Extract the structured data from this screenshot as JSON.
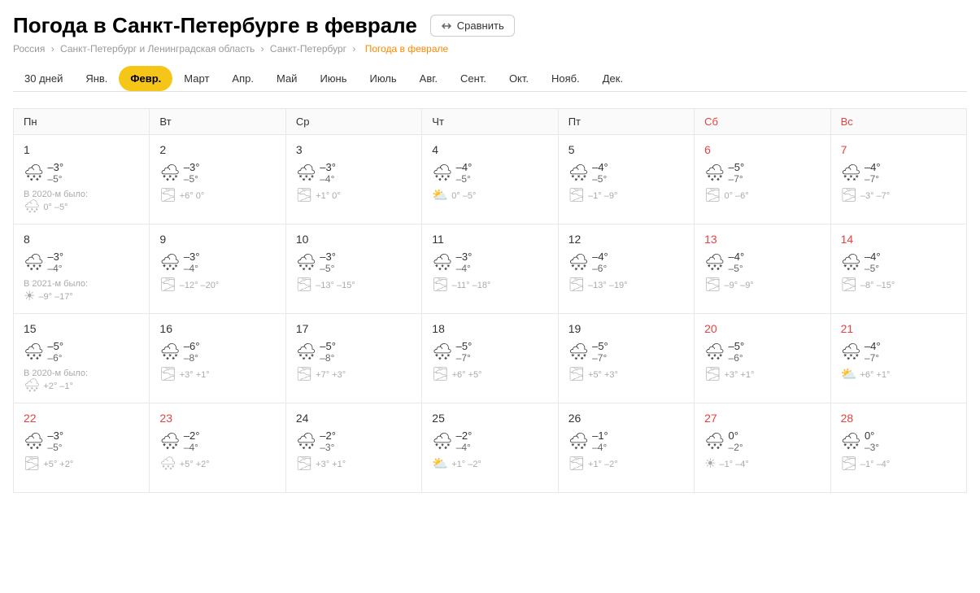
{
  "page": {
    "title": "Погода в Санкт-Петербурге в феврале",
    "compare_btn": "Сравнить",
    "breadcrumb": {
      "items": [
        "Россия",
        "Санкт-Петербург и Ленинградская область",
        "Санкт-Петербург"
      ],
      "current": "Погода в феврале"
    }
  },
  "tabs": [
    {
      "label": "30 дней",
      "active": false
    },
    {
      "label": "Янв.",
      "active": false
    },
    {
      "label": "Февр.",
      "active": true
    },
    {
      "label": "Март",
      "active": false
    },
    {
      "label": "Апр.",
      "active": false
    },
    {
      "label": "Май",
      "active": false
    },
    {
      "label": "Июнь",
      "active": false
    },
    {
      "label": "Июль",
      "active": false
    },
    {
      "label": "Авг.",
      "active": false
    },
    {
      "label": "Сент.",
      "active": false
    },
    {
      "label": "Окт.",
      "active": false
    },
    {
      "label": "Нояб.",
      "active": false
    },
    {
      "label": "Дек.",
      "active": false
    }
  ],
  "headers": [
    {
      "label": "Пн",
      "weekend": false
    },
    {
      "label": "Вт",
      "weekend": false
    },
    {
      "label": "Ср",
      "weekend": false
    },
    {
      "label": "Чт",
      "weekend": false
    },
    {
      "label": "Пт",
      "weekend": false
    },
    {
      "label": "Сб",
      "weekend": true
    },
    {
      "label": "Вс",
      "weekend": true
    }
  ],
  "days": [
    {
      "num": "1",
      "weekend": false,
      "today": false,
      "icon": "cloud-snow",
      "high": "–3°",
      "low": "–5°",
      "has_prev": true,
      "prev_label": "В 2020-м было:",
      "prev_icon": "cloud-snow",
      "prev_temps": "0° –5°"
    },
    {
      "num": "2",
      "weekend": false,
      "today": false,
      "icon": "cloud-snow",
      "high": "–3°",
      "low": "–5°",
      "has_prev": true,
      "prev_label": "",
      "prev_icon": "fog",
      "prev_temps": "+6° 0°"
    },
    {
      "num": "3",
      "weekend": false,
      "today": false,
      "icon": "cloud-snow",
      "high": "–3°",
      "low": "–4°",
      "has_prev": true,
      "prev_label": "",
      "prev_icon": "fog",
      "prev_temps": "+1° 0°"
    },
    {
      "num": "4",
      "weekend": false,
      "today": false,
      "icon": "cloud-snow",
      "high": "–4°",
      "low": "–5°",
      "has_prev": true,
      "prev_label": "",
      "prev_icon": "sun-cloud",
      "prev_temps": "0° –5°"
    },
    {
      "num": "5",
      "weekend": false,
      "today": false,
      "icon": "cloud-snow",
      "high": "–4°",
      "low": "–5°",
      "has_prev": true,
      "prev_label": "",
      "prev_icon": "fog",
      "prev_temps": "–1° –9°"
    },
    {
      "num": "6",
      "weekend": true,
      "today": false,
      "icon": "cloud-snow",
      "high": "–5°",
      "low": "–7°",
      "has_prev": true,
      "prev_label": "",
      "prev_icon": "fog",
      "prev_temps": "0° –6°"
    },
    {
      "num": "7",
      "weekend": true,
      "today": false,
      "icon": "cloud-snow",
      "high": "–4°",
      "low": "–7°",
      "has_prev": true,
      "prev_label": "",
      "prev_icon": "fog",
      "prev_temps": "–3° –7°"
    },
    {
      "num": "8",
      "weekend": false,
      "today": false,
      "icon": "cloud-snow",
      "high": "–3°",
      "low": "–4°",
      "has_prev": true,
      "prev_label": "В 2021-м было:",
      "prev_icon": "sun",
      "prev_temps": "–9° –17°"
    },
    {
      "num": "9",
      "weekend": false,
      "today": false,
      "icon": "cloud-snow",
      "high": "–3°",
      "low": "–4°",
      "has_prev": true,
      "prev_label": "",
      "prev_icon": "fog",
      "prev_temps": "–12° –20°"
    },
    {
      "num": "10",
      "weekend": false,
      "today": false,
      "icon": "cloud-snow",
      "high": "–3°",
      "low": "–5°",
      "has_prev": true,
      "prev_label": "",
      "prev_icon": "fog",
      "prev_temps": "–13° –15°"
    },
    {
      "num": "11",
      "weekend": false,
      "today": false,
      "icon": "cloud-snow",
      "high": "–3°",
      "low": "–4°",
      "has_prev": true,
      "prev_label": "",
      "prev_icon": "fog",
      "prev_temps": "–11° –18°"
    },
    {
      "num": "12",
      "weekend": false,
      "today": false,
      "icon": "cloud-snow",
      "high": "–4°",
      "low": "–6°",
      "has_prev": true,
      "prev_label": "",
      "prev_icon": "fog",
      "prev_temps": "–13° –19°"
    },
    {
      "num": "13",
      "weekend": true,
      "today": false,
      "icon": "cloud-snow",
      "high": "–4°",
      "low": "–5°",
      "has_prev": true,
      "prev_label": "",
      "prev_icon": "fog",
      "prev_temps": "–9° –9°"
    },
    {
      "num": "14",
      "weekend": true,
      "today": false,
      "icon": "cloud-snow",
      "high": "–4°",
      "low": "–5°",
      "has_prev": true,
      "prev_label": "",
      "prev_icon": "fog",
      "prev_temps": "–8° –15°"
    },
    {
      "num": "15",
      "weekend": false,
      "today": true,
      "icon": "cloud-snow",
      "high": "–5°",
      "low": "–6°",
      "has_prev": true,
      "prev_label": "В 2020-м было:",
      "prev_icon": "cloud-snow",
      "prev_temps": "+2° –1°"
    },
    {
      "num": "16",
      "weekend": false,
      "today": false,
      "icon": "cloud-snow",
      "high": "–6°",
      "low": "–8°",
      "has_prev": true,
      "prev_label": "",
      "prev_icon": "fog",
      "prev_temps": "+3° +1°"
    },
    {
      "num": "17",
      "weekend": false,
      "today": false,
      "icon": "cloud-snow",
      "high": "–5°",
      "low": "–8°",
      "has_prev": true,
      "prev_label": "",
      "prev_icon": "fog",
      "prev_temps": "+7° +3°"
    },
    {
      "num": "18",
      "weekend": false,
      "today": false,
      "icon": "cloud-snow",
      "high": "–5°",
      "low": "–7°",
      "has_prev": true,
      "prev_label": "",
      "prev_icon": "fog",
      "prev_temps": "+6° +5°"
    },
    {
      "num": "19",
      "weekend": false,
      "today": false,
      "icon": "cloud-snow",
      "high": "–5°",
      "low": "–7°",
      "has_prev": true,
      "prev_label": "",
      "prev_icon": "fog",
      "prev_temps": "+5° +3°"
    },
    {
      "num": "20",
      "weekend": true,
      "today": false,
      "icon": "cloud-snow",
      "high": "–5°",
      "low": "–6°",
      "has_prev": true,
      "prev_label": "",
      "prev_icon": "fog",
      "prev_temps": "+3° +1°"
    },
    {
      "num": "21",
      "weekend": true,
      "today": false,
      "icon": "cloud-snow",
      "high": "–4°",
      "low": "–7°",
      "has_prev": true,
      "prev_label": "",
      "prev_icon": "sun-cloud",
      "prev_temps": "+6° +1°"
    },
    {
      "num": "22",
      "weekend": true,
      "today": false,
      "icon": "cloud-snow",
      "high": "–3°",
      "low": "–5°",
      "has_prev": true,
      "prev_label": "",
      "prev_icon": "fog",
      "prev_temps": "+5° +2°"
    },
    {
      "num": "23",
      "weekend": true,
      "today": false,
      "icon": "cloud-snow",
      "high": "–2°",
      "low": "–4°",
      "has_prev": true,
      "prev_label": "",
      "prev_icon": "cloud-snow",
      "prev_temps": "+5° +2°"
    },
    {
      "num": "24",
      "weekend": false,
      "today": false,
      "icon": "cloud-snow",
      "high": "–2°",
      "low": "–3°",
      "has_prev": true,
      "prev_label": "",
      "prev_icon": "fog",
      "prev_temps": "+3° +1°"
    },
    {
      "num": "25",
      "weekend": false,
      "today": false,
      "icon": "cloud-snow",
      "high": "–2°",
      "low": "–4°",
      "has_prev": true,
      "prev_label": "",
      "prev_icon": "sun-cloud",
      "prev_temps": "+1° –2°"
    },
    {
      "num": "26",
      "weekend": false,
      "today": false,
      "icon": "cloud-snow",
      "high": "–1°",
      "low": "–4°",
      "has_prev": true,
      "prev_label": "",
      "prev_icon": "fog",
      "prev_temps": "+1° –2°"
    },
    {
      "num": "27",
      "weekend": true,
      "today": false,
      "icon": "cloud-snow",
      "high": "0°",
      "low": "–2°",
      "has_prev": true,
      "prev_label": "",
      "prev_icon": "sun",
      "prev_temps": "–1° –4°"
    },
    {
      "num": "28",
      "weekend": true,
      "today": false,
      "icon": "cloud-snow",
      "high": "0°",
      "low": "–3°",
      "has_prev": true,
      "prev_label": "",
      "prev_icon": "fog",
      "prev_temps": "–1° –4°"
    }
  ],
  "row4_start_col": 1
}
